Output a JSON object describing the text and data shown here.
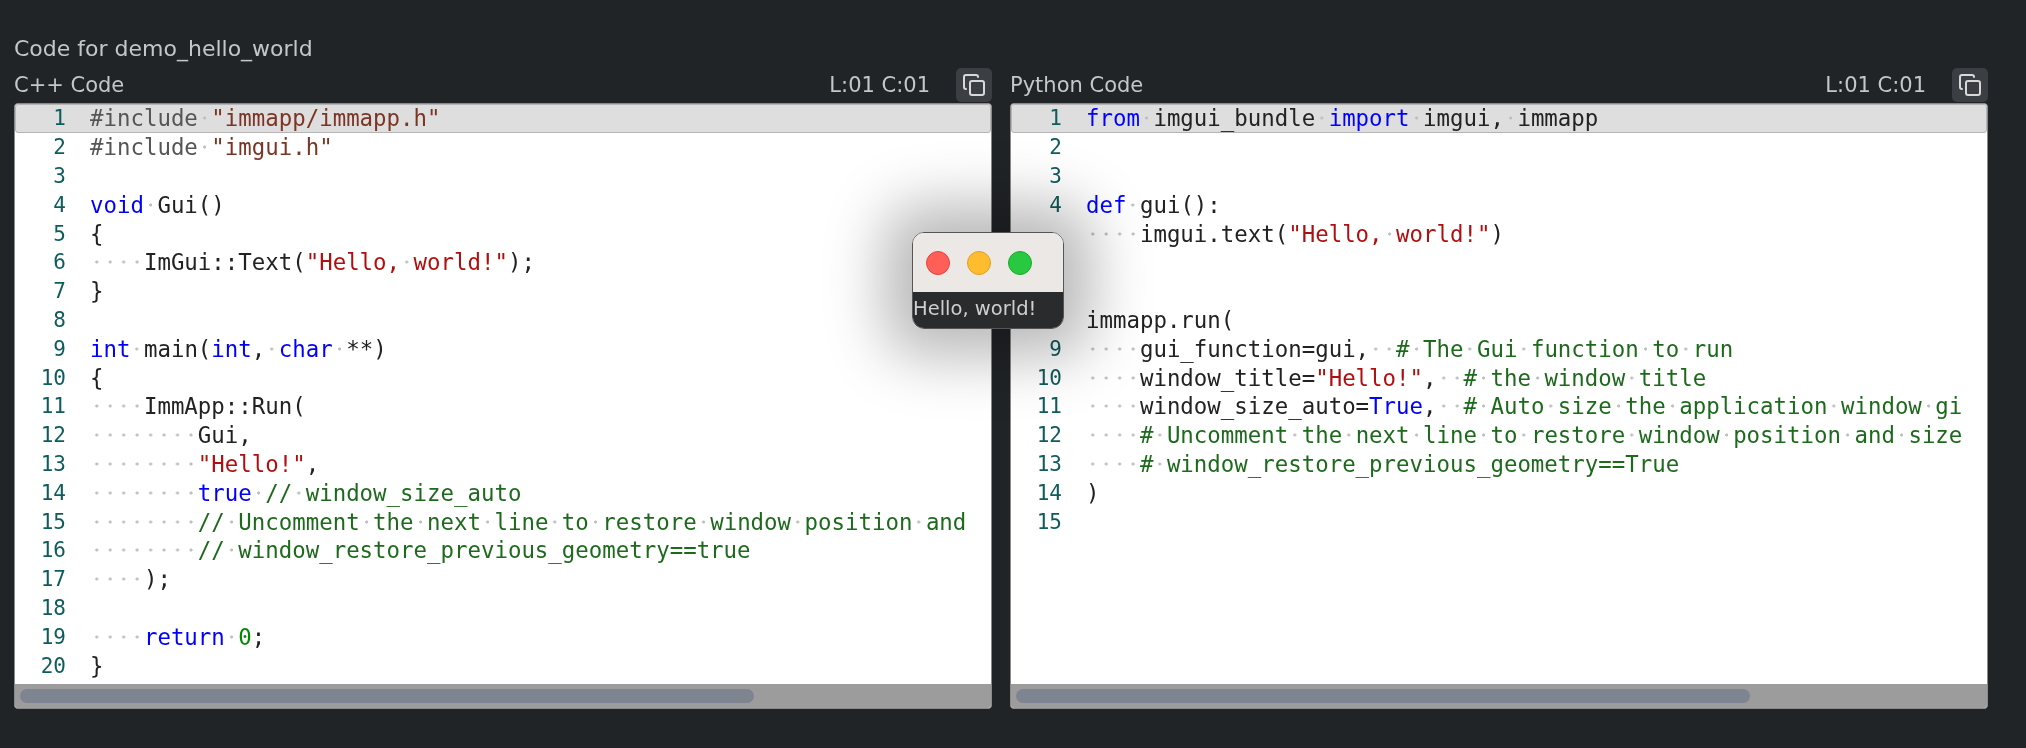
{
  "title": "Code for demo_hello_world",
  "editors": [
    {
      "label": "C++ Code",
      "position": "L:01 C:01",
      "lines": [
        {
          "number": "1",
          "current": true,
          "tokens": [
            {
              "text": "#include ",
              "kind": "preproc"
            },
            {
              "text": "\"immapp/immapp.h\"",
              "kind": "include"
            }
          ]
        },
        {
          "number": "2",
          "current": false,
          "tokens": [
            {
              "text": "#include ",
              "kind": "preproc"
            },
            {
              "text": "\"imgui.h\"",
              "kind": "include"
            }
          ]
        },
        {
          "number": "3",
          "current": false
        },
        {
          "number": "4",
          "current": false,
          "tokens": [
            {
              "text": "void",
              "kind": "keyword"
            },
            {
              "text": " Gui()",
              "kind": "plain"
            }
          ]
        },
        {
          "number": "5",
          "current": false,
          "tokens": [
            {
              "text": "{",
              "kind": "plain"
            }
          ]
        },
        {
          "number": "6",
          "current": false,
          "tokens": [
            {
              "text": "    ImGui::Text(",
              "kind": "plain"
            },
            {
              "text": "\"Hello, world!\"",
              "kind": "string"
            },
            {
              "text": ");",
              "kind": "plain"
            }
          ]
        },
        {
          "number": "7",
          "current": false,
          "tokens": [
            {
              "text": "}",
              "kind": "plain"
            }
          ]
        },
        {
          "number": "8",
          "current": false
        },
        {
          "number": "9",
          "current": false,
          "tokens": [
            {
              "text": "int",
              "kind": "keyword"
            },
            {
              "text": " main(",
              "kind": "plain"
            },
            {
              "text": "int",
              "kind": "keyword"
            },
            {
              "text": ", ",
              "kind": "plain"
            },
            {
              "text": "char",
              "kind": "keyword"
            },
            {
              "text": " **)",
              "kind": "plain"
            }
          ]
        },
        {
          "number": "10",
          "current": false,
          "tokens": [
            {
              "text": "{",
              "kind": "plain"
            }
          ]
        },
        {
          "number": "11",
          "current": false,
          "tokens": [
            {
              "text": "    ImmApp::Run(",
              "kind": "plain"
            }
          ]
        },
        {
          "number": "12",
          "current": false,
          "tokens": [
            {
              "text": "        Gui,",
              "kind": "plain"
            }
          ]
        },
        {
          "number": "13",
          "current": false,
          "tokens": [
            {
              "text": "        \"Hello!\"",
              "kind": "string"
            },
            {
              "text": ",",
              "kind": "plain"
            }
          ]
        },
        {
          "number": "14",
          "current": false,
          "tokens": [
            {
              "text": "        true",
              "kind": "keyword"
            },
            {
              "text": " // window_size_auto",
              "kind": "comment"
            }
          ]
        },
        {
          "number": "15",
          "current": false,
          "tokens": [
            {
              "text": "        // Uncomment the next line to restore window position and",
              "kind": "comment"
            }
          ]
        },
        {
          "number": "16",
          "current": false,
          "tokens": [
            {
              "text": "        // window_restore_previous_geometry==true",
              "kind": "comment"
            }
          ]
        },
        {
          "number": "17",
          "current": false,
          "tokens": [
            {
              "text": "    );",
              "kind": "plain"
            }
          ]
        },
        {
          "number": "18",
          "current": false
        },
        {
          "number": "19",
          "current": false,
          "tokens": [
            {
              "text": "    return",
              "kind": "keyword"
            },
            {
              "text": " 0",
              "kind": "number"
            },
            {
              "text": ";",
              "kind": "plain"
            }
          ]
        },
        {
          "number": "20",
          "current": false,
          "tokens": [
            {
              "text": "}",
              "kind": "plain"
            }
          ]
        }
      ]
    },
    {
      "label": "Python Code",
      "position": "L:01 C:01",
      "lines": [
        {
          "number": "1",
          "current": true,
          "tokens": [
            {
              "text": "from",
              "kind": "keyword"
            },
            {
              "text": " imgui_bundle ",
              "kind": "plain"
            },
            {
              "text": "import",
              "kind": "keyword"
            },
            {
              "text": " imgui, immapp",
              "kind": "plain"
            }
          ]
        },
        {
          "number": "2",
          "current": false
        },
        {
          "number": "3",
          "current": false
        },
        {
          "number": "4",
          "current": false,
          "tokens": [
            {
              "text": "def",
              "kind": "keyword"
            },
            {
              "text": " gui():",
              "kind": "plain"
            }
          ]
        },
        {
          "current": false,
          "tokens": [
            {
              "text": "    imgui.text(",
              "kind": "plain"
            },
            {
              "text": "\"Hello, world!\"",
              "kind": "string"
            },
            {
              "text": ")",
              "kind": "plain"
            }
          ]
        },
        {
          "current": false
        },
        {
          "current": false
        },
        {
          "current": false,
          "tokens": [
            {
              "text": "immapp.run(",
              "kind": "plain"
            }
          ]
        },
        {
          "number": "9",
          "current": false,
          "tokens": [
            {
              "text": "    gui_function=gui,  ",
              "kind": "plain"
            },
            {
              "text": "# The Gui function to run",
              "kind": "comment"
            }
          ]
        },
        {
          "number": "10",
          "current": false,
          "tokens": [
            {
              "text": "    window_title=",
              "kind": "plain"
            },
            {
              "text": "\"Hello!\"",
              "kind": "string"
            },
            {
              "text": ",  ",
              "kind": "plain"
            },
            {
              "text": "# the window title",
              "kind": "comment"
            }
          ]
        },
        {
          "number": "11",
          "current": false,
          "tokens": [
            {
              "text": "    window_size_auto=",
              "kind": "plain"
            },
            {
              "text": "True",
              "kind": "keyword"
            },
            {
              "text": ",  ",
              "kind": "plain"
            },
            {
              "text": "# Auto size the application window gi",
              "kind": "comment"
            }
          ]
        },
        {
          "number": "12",
          "current": false,
          "tokens": [
            {
              "text": "    # Uncomment the next line to restore window position and size",
              "kind": "comment"
            }
          ]
        },
        {
          "number": "13",
          "current": false,
          "tokens": [
            {
              "text": "    # window_restore_previous_geometry==True",
              "kind": "comment"
            }
          ]
        },
        {
          "number": "14",
          "current": false,
          "tokens": [
            {
              "text": ")",
              "kind": "plain"
            }
          ]
        },
        {
          "number": "15",
          "current": false
        }
      ]
    }
  ],
  "floating_window": {
    "text": "Hello, world!",
    "buttons": [
      {
        "kind": "close",
        "color": "#ff5f57"
      },
      {
        "kind": "minimize",
        "color": "#febc2e"
      },
      {
        "kind": "zoom",
        "color": "#28c840"
      }
    ]
  }
}
